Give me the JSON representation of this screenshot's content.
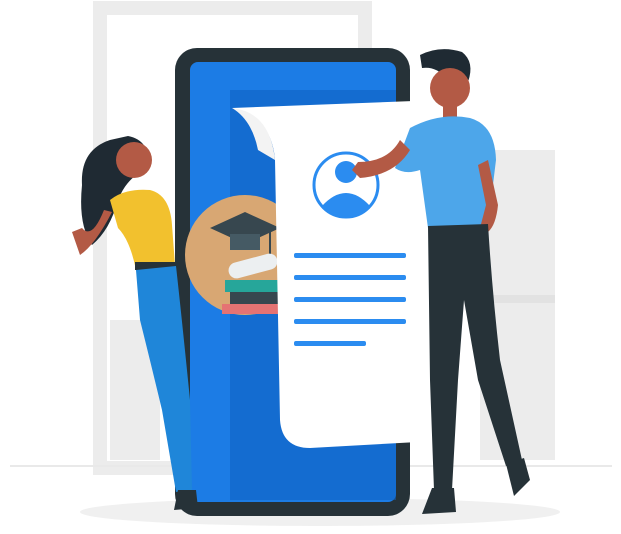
{
  "illustration": {
    "subject": "online-profile-resume",
    "colors": {
      "phone_frame": "#263238",
      "phone_screen": "#1c7ce5",
      "phone_screen_dark": "#0f5fc0",
      "document": "#ffffff",
      "avatar_blue": "#2b8cf0",
      "lines_blue": "#2b8cf0",
      "woman_shirt": "#f2c12e",
      "woman_pants": "#1f86d9",
      "man_shirt": "#4da6ea",
      "man_pants": "#263238",
      "skin": "#b35a45",
      "hair": "#1f2a33",
      "background_shapes": "#ebebeb",
      "floor_shadow": "#f0f0f0"
    },
    "icons": [
      "user-avatar-icon",
      "graduation-cap-icon",
      "books-icon",
      "diploma-scroll-icon"
    ]
  }
}
